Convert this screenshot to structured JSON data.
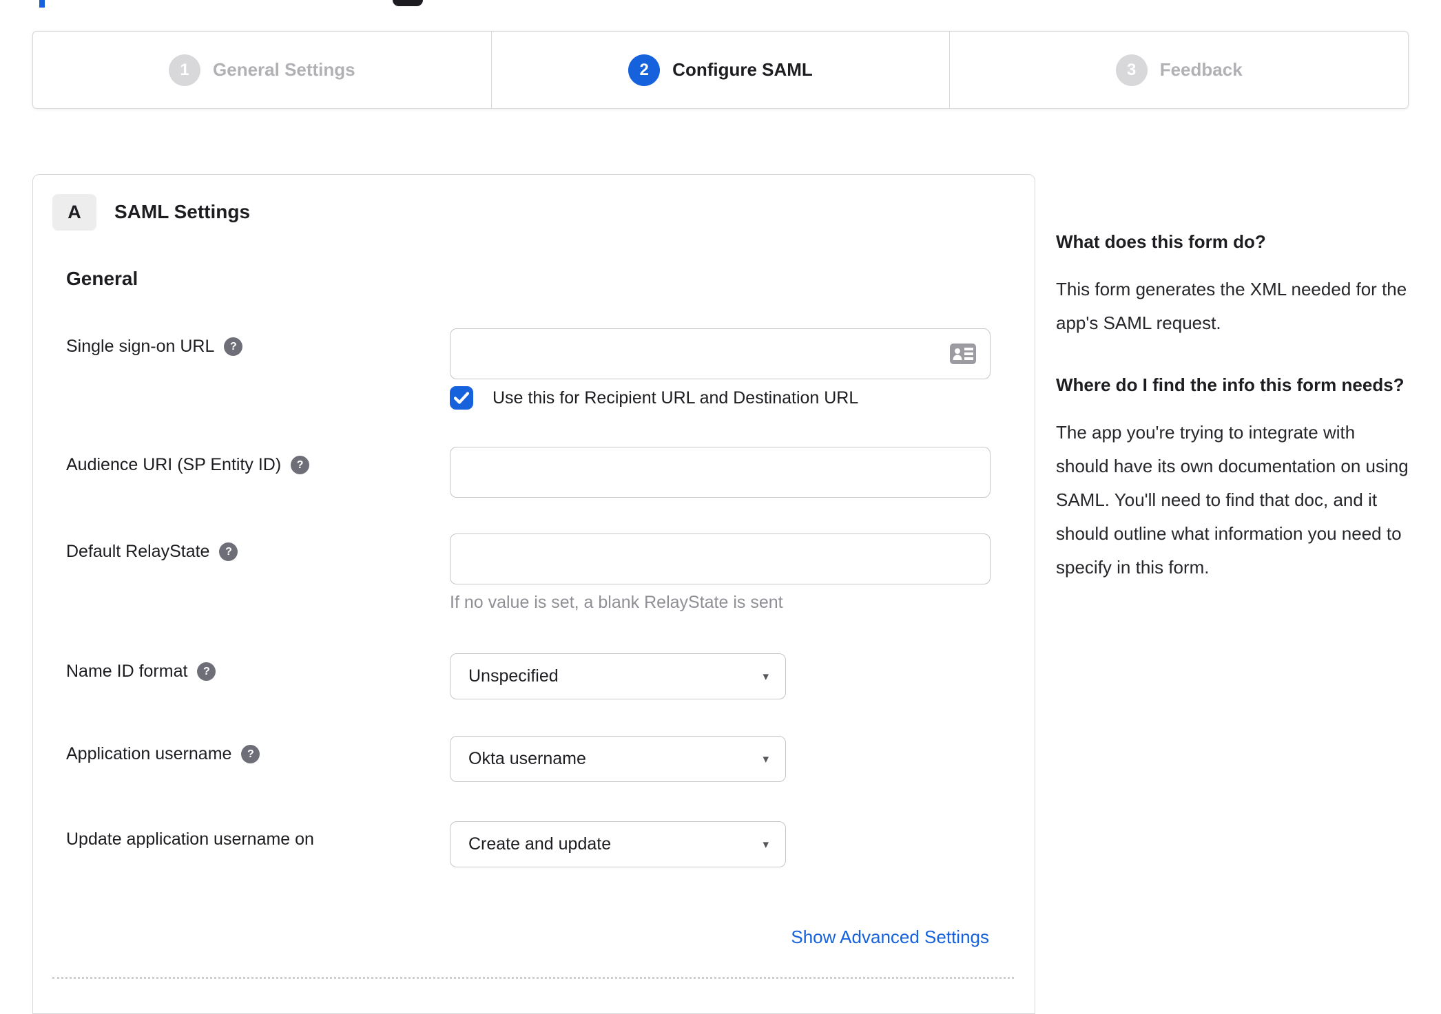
{
  "colors": {
    "accent_blue": "#1662dd",
    "dark_text": "#1d1d21",
    "inactive_gray": "#b0b0b5",
    "border_gray": "#d8d8da",
    "input_border": "#c6c6c9",
    "helper_gray": "#8f8f96",
    "help_icon_bg": "#6e6e78",
    "badge_bg": "#ededee"
  },
  "stepper": {
    "steps": [
      {
        "number": "1",
        "label": "General Settings",
        "active": false
      },
      {
        "number": "2",
        "label": "Configure SAML",
        "active": true
      },
      {
        "number": "3",
        "label": "Feedback",
        "active": false
      }
    ]
  },
  "panel": {
    "badge": "A",
    "title": "SAML Settings",
    "group": "General",
    "help_icon_glyph": "?",
    "fields": {
      "sso": {
        "label": "Single sign-on URL",
        "value": ""
      },
      "audience": {
        "label": "Audience URI (SP Entity ID)",
        "value": ""
      },
      "relay": {
        "label": "Default RelayState",
        "value": "",
        "helper": "If no value is set, a blank RelayState is sent"
      },
      "nameid": {
        "label": "Name ID format",
        "value": "Unspecified"
      },
      "appuser": {
        "label": "Application username",
        "value": "Okta username"
      },
      "update": {
        "label": "Update application username on",
        "value": "Create and update"
      }
    },
    "checkbox": {
      "label": "Use this for Recipient URL and Destination URL",
      "checked": true
    },
    "select_caret": "▾",
    "advanced_link": "Show Advanced Settings"
  },
  "sidebar": {
    "q1": "What does this form do?",
    "a1": "This form generates the XML needed for the app's SAML request.",
    "q2": "Where do I find the info this form needs?",
    "a2": "The app you're trying to integrate with should have its own documentation on using SAML. You'll need to find that doc, and it should outline what information you need to specify in this form."
  }
}
